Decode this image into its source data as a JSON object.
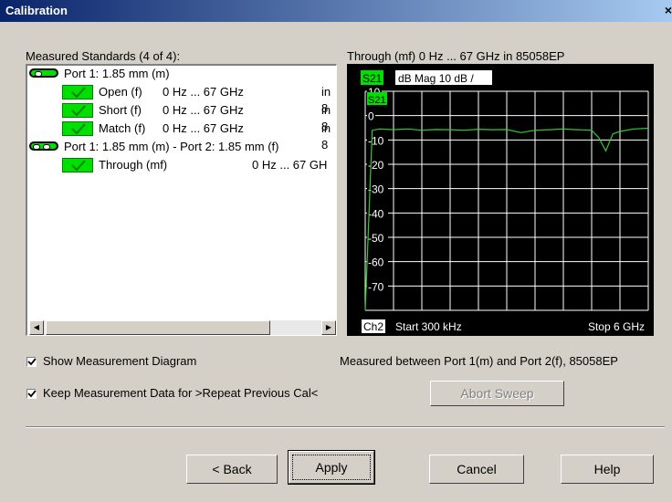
{
  "window": {
    "title": "Calibration",
    "close": "×"
  },
  "standards": {
    "header": "Measured Standards (4 of 4):",
    "port1": "Port 1: 1.85 mm (m)",
    "items1": [
      {
        "name": "Open (f)",
        "range": "0 Hz ... 67 GHz",
        "tail": "in 8"
      },
      {
        "name": "Short (f)",
        "range": "0 Hz ... 67 GHz",
        "tail": "in 8"
      },
      {
        "name": "Match (f)",
        "range": "0 Hz ... 67 GHz",
        "tail": "in 8"
      }
    ],
    "port12": "Port 1: 1.85 mm (m) - Port 2: 1.85 mm (f)",
    "items2": [
      {
        "name": "Through (mf)",
        "range": "0 Hz ... 67 GH"
      }
    ]
  },
  "graph": {
    "header": "Through  (mf) 0 Hz ... 67 GHz in 85058EP",
    "trace": "S21",
    "format": "dB Mag 10 dB /",
    "marker": "S21",
    "channel": "Ch2",
    "start": "Start 300 kHz",
    "stop": "Stop 6 GHz",
    "colors": {
      "trace": "#33cc33",
      "background": "#000000",
      "grid": "#ffffff"
    }
  },
  "chart_data": {
    "type": "line",
    "ylabels": [
      "10",
      "0",
      "-10",
      "-20",
      "-30",
      "-40",
      "-50",
      "-60",
      "-70"
    ],
    "ylim": [
      -80,
      10
    ],
    "xlim": [
      0.0003,
      6
    ],
    "series": [
      {
        "name": "S21",
        "x": [
          0.0003,
          0.15,
          0.3,
          0.6,
          0.9,
          1.2,
          1.5,
          1.8,
          2.1,
          2.4,
          2.7,
          3.0,
          3.3,
          3.6,
          3.9,
          4.2,
          4.5,
          4.8,
          4.95,
          5.1,
          5.25,
          5.4,
          5.7,
          6.0
        ],
        "y": [
          -80,
          -6,
          -5.5,
          -5.8,
          -5.5,
          -6.0,
          -5.7,
          -5.8,
          -6.0,
          -5.6,
          -5.8,
          -5.7,
          -7.0,
          -6.0,
          -5.8,
          -5.5,
          -5.8,
          -6.0,
          -9.0,
          -14.5,
          -7.5,
          -6.5,
          -5.5,
          -5.2
        ]
      }
    ]
  },
  "options": {
    "show_diagram": "Show Measurement Diagram",
    "keep_data": "Keep Measurement Data for >Repeat Previous Cal<",
    "measured_between": "Measured between Port 1(m) and Port 2(f), 85058EP",
    "abort": "Abort Sweep"
  },
  "buttons": {
    "back": "< Back",
    "apply": "Apply",
    "cancel": "Cancel",
    "help": "Help"
  }
}
